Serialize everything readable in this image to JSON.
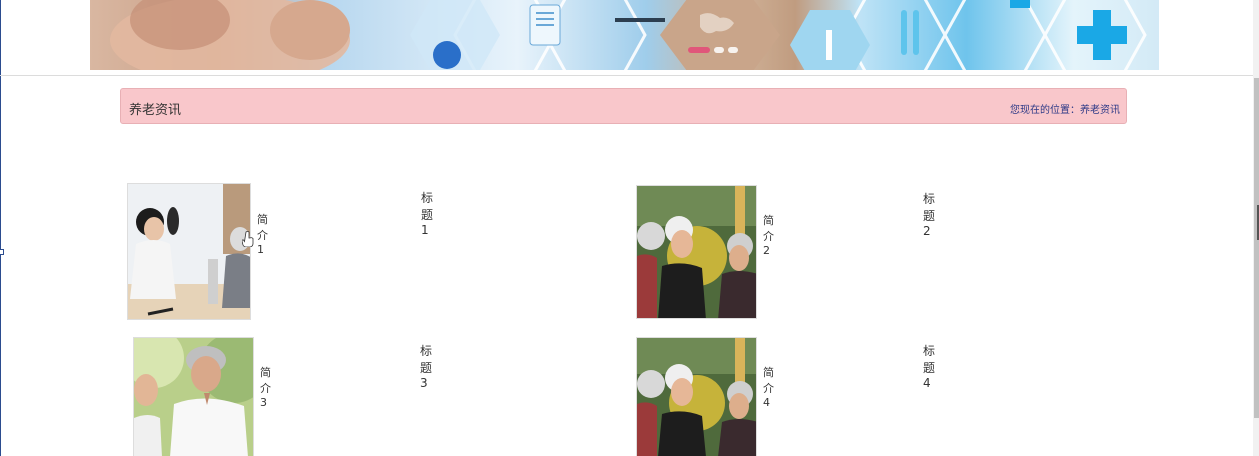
{
  "banner": {
    "slides": 3,
    "active_slide": 1
  },
  "section": {
    "title": "养老资讯",
    "breadcrumb_prefix": "您现在的位置：",
    "breadcrumb_current": "养老资讯"
  },
  "news": [
    {
      "title": "标题1",
      "desc": "简介1",
      "image": "nurse-checking-blood-pressure"
    },
    {
      "title": "标题2",
      "desc": "简介2",
      "image": "elderly-women-group"
    },
    {
      "title": "标题3",
      "desc": "简介3",
      "image": "elderly-men-laughing"
    },
    {
      "title": "标题4",
      "desc": "简介4",
      "image": "elderly-women-group"
    }
  ],
  "colors": {
    "title_bar_bg": "#f9c7cb",
    "breadcrumb": "#2e3a87",
    "active_dot": "#e0567a"
  }
}
